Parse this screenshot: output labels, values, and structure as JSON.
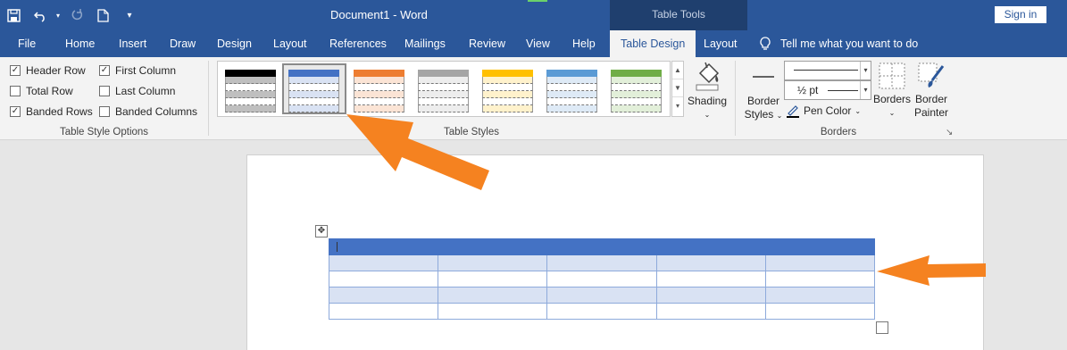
{
  "app": {
    "document_title": "Document1",
    "app_name": "Word",
    "title_separator": "-",
    "contextual_tab_set": "Table Tools",
    "sign_in_label": "Sign in"
  },
  "qat": {
    "save_icon": "save-icon",
    "undo_icon": "undo-icon",
    "redo_icon": "redo-icon",
    "new_icon": "new-document-icon",
    "customize_icon": "customize-qat-icon"
  },
  "tabs": [
    {
      "label": "File"
    },
    {
      "label": "Home"
    },
    {
      "label": "Insert"
    },
    {
      "label": "Draw"
    },
    {
      "label": "Design"
    },
    {
      "label": "Layout"
    },
    {
      "label": "References"
    },
    {
      "label": "Mailings"
    },
    {
      "label": "Review"
    },
    {
      "label": "View"
    },
    {
      "label": "Help"
    },
    {
      "label": "Table Design",
      "active": true
    },
    {
      "label": "Layout"
    }
  ],
  "tell_me": {
    "icon": "lightbulb-icon",
    "placeholder": "Tell me what you want to do"
  },
  "table_style_options": {
    "group_label": "Table Style Options",
    "options": [
      {
        "label": "Header Row",
        "checked": true
      },
      {
        "label": "First Column",
        "checked": true
      },
      {
        "label": "Total Row",
        "checked": false
      },
      {
        "label": "Last Column",
        "checked": false
      },
      {
        "label": "Banded Rows",
        "checked": true
      },
      {
        "label": "Banded Columns",
        "checked": false
      }
    ]
  },
  "table_styles": {
    "group_label": "Table Styles",
    "thumbnails": [
      {
        "header_color": "#000000",
        "band_color": "#bfbfbf"
      },
      {
        "header_color": "#4472c4",
        "band_color": "#d9e2f3",
        "selected": true
      },
      {
        "header_color": "#ed7d31",
        "band_color": "#fbe4d5"
      },
      {
        "header_color": "#a5a5a5",
        "band_color": "#ededed"
      },
      {
        "header_color": "#ffc000",
        "band_color": "#fff2cc"
      },
      {
        "header_color": "#5b9bd5",
        "band_color": "#deeaf6"
      },
      {
        "header_color": "#70ad47",
        "band_color": "#e2efd9"
      }
    ],
    "shading_label": "Shading"
  },
  "borders": {
    "group_label": "Borders",
    "border_styles_label_1": "Border",
    "border_styles_label_2": "Styles",
    "weight_value": "½ pt",
    "pen_color_label": "Pen Color",
    "borders_label": "Borders",
    "border_painter_label_1": "Border",
    "border_painter_label_2": "Painter"
  },
  "document_table": {
    "header_color": "#4472c4",
    "band_color": "#d9e2f3",
    "border_color": "#8eaadb",
    "columns": 5,
    "rows": 5
  },
  "annotations": {
    "arrow_color": "#f58220"
  }
}
